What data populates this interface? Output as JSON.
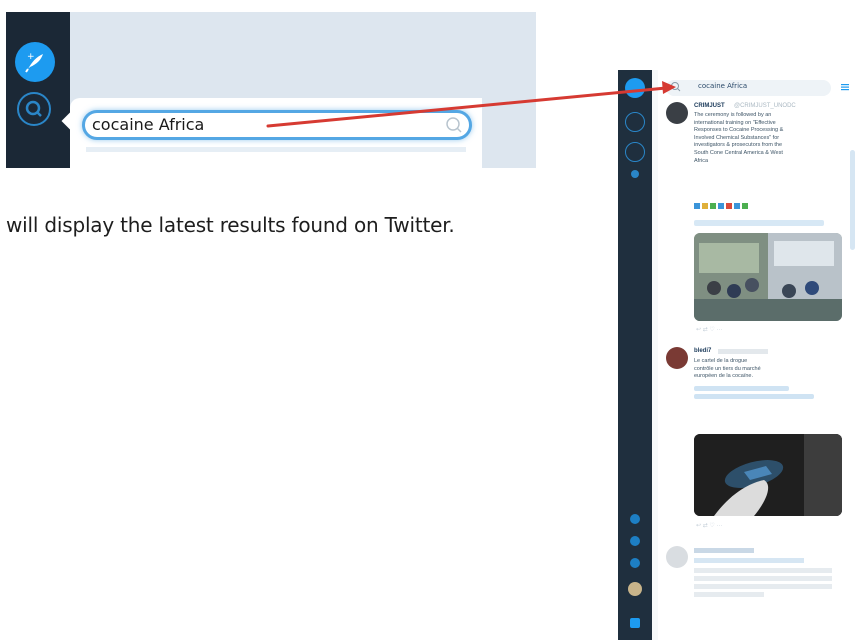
{
  "zoom": {
    "search_value": "cocaine Africa"
  },
  "caption": "will display the latest results found on Twitter.",
  "tweetdeck": {
    "search_value": "cocaine Africa",
    "tweets": [
      {
        "name": "CRIMJUST",
        "handle": "@CRIMJUST_UNODC",
        "text_lines": [
          "The ceremony is followed by an",
          "international training on \"Effective",
          "Responses to Cocaine Processing &",
          "Involved Chemical Substances\" for",
          "investigators & prosecutors from the",
          "South Cone Central America & West",
          "Africa"
        ],
        "retweet_line": "",
        "actions": ""
      },
      {
        "name": "bledi7",
        "handle": "",
        "text_lines": [
          "Le cartel de la drogue",
          "contrôle un tiers du marché",
          "européen de la cocaïne."
        ],
        "link_lines": [],
        "actions": ""
      },
      {
        "name": "",
        "handle": "",
        "text_lines": [],
        "actions": ""
      }
    ]
  },
  "colors": {
    "arrow": "#d63a32",
    "accent": "#1d9bf0",
    "nav_bg": "#1f2f3e"
  }
}
